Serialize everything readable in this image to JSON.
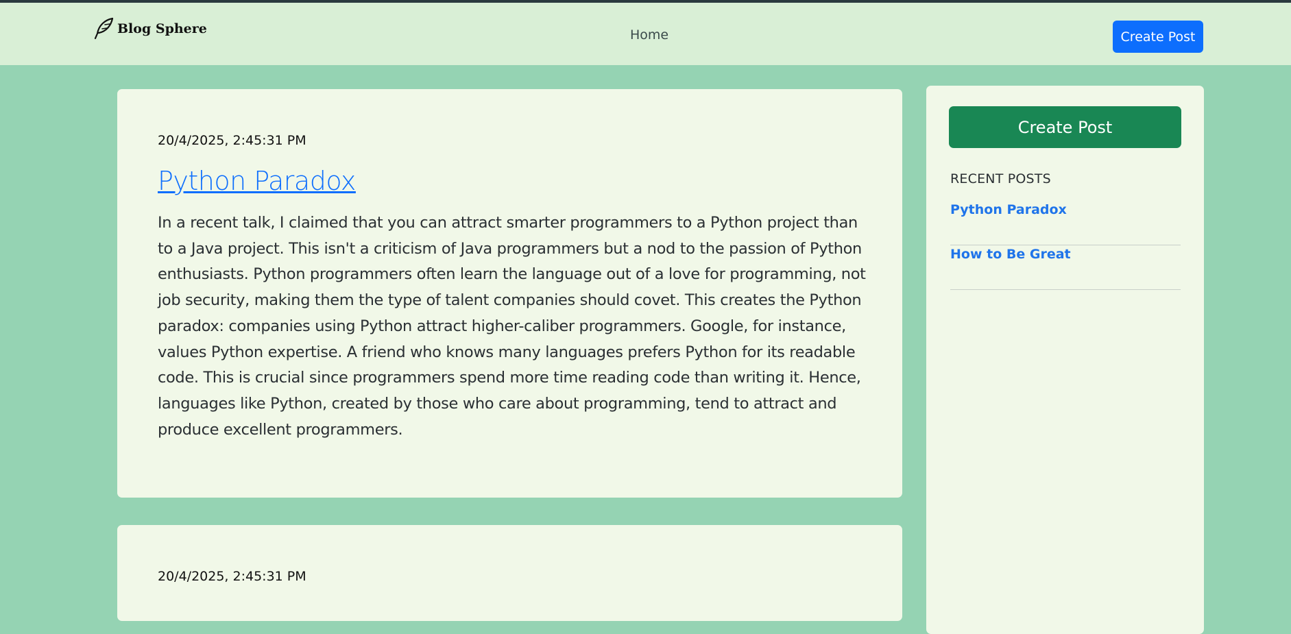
{
  "navbar": {
    "brand": "Blog Sphere",
    "brand_icon": "feather-icon",
    "home_label": "Home",
    "create_label": "Create Post"
  },
  "posts": [
    {
      "date": "20/4/2025, 2:45:31 PM",
      "title": "Python Paradox",
      "body": "In a recent talk, I claimed that you can attract smarter programmers to a Python project than to a Java project. This isn't a criticism of Java programmers but a nod to the passion of Python enthusiasts. Python programmers often learn the language out of a love for programming, not job security, making them the type of talent companies should covet. This creates the Python paradox: companies using Python attract higher-caliber programmers. Google, for instance, values Python expertise. A friend who knows many languages prefers Python for its readable code. This is crucial since programmers spend more time reading code than writing it. Hence, languages like Python, created by those who care about programming, tend to attract and produce excellent programmers."
    },
    {
      "date": "20/4/2025, 2:45:31 PM"
    }
  ],
  "sidebar": {
    "create_label": "Create Post",
    "recent_heading": "RECENT POSTS",
    "recent_posts": [
      "Python Paradox",
      "How to Be Great"
    ]
  },
  "colors": {
    "background": "#95d3b3",
    "navbar": "#d9efd6",
    "card": "#f1f8e8",
    "primary": "#0d6efd",
    "success": "#198754"
  }
}
